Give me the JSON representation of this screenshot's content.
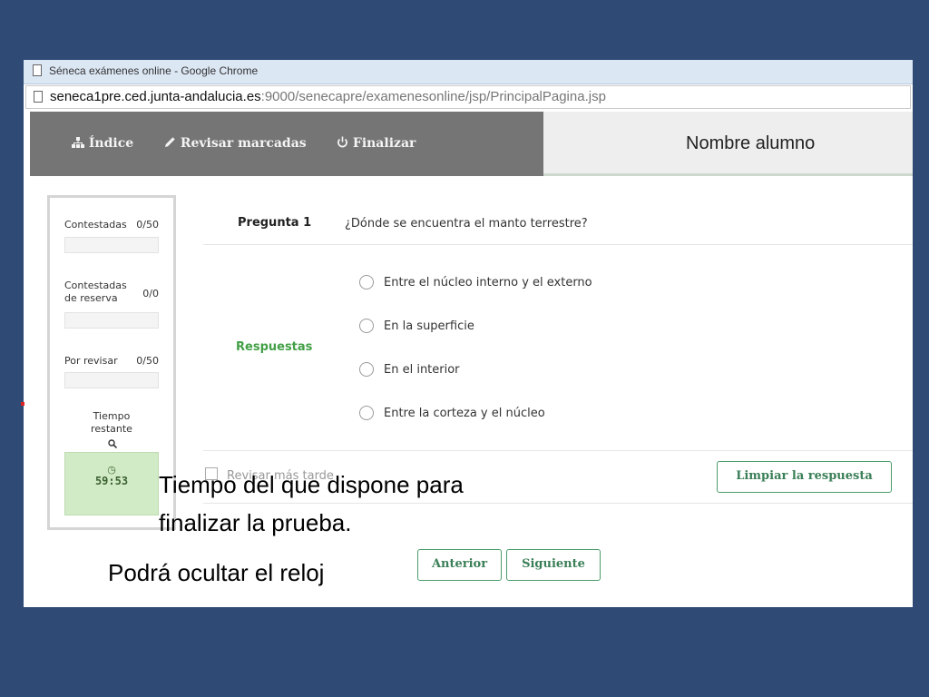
{
  "browser": {
    "window_title": "Séneca exámenes online - Google Chrome",
    "url_domain": "seneca1pre.ced.junta-andalucia.es",
    "url_path": ":9000/senecapre/examenesonline/jsp/PrincipalPagina.jsp"
  },
  "nav": {
    "index_label": "Índice",
    "review_marked_label": "Revisar marcadas",
    "finish_label": "Finalizar",
    "student_name": "Nombre alumno"
  },
  "sidebar": {
    "answered_label": "Contestadas",
    "answered_count": "0/50",
    "reserve_label_line1": "Contestadas",
    "reserve_label_line2": "de reserva",
    "reserve_count": "0/0",
    "to_review_label": "Por revisar",
    "to_review_count": "0/50",
    "time_label_line1": "Tiempo",
    "time_label_line2": "restante",
    "time_remaining": "59:53"
  },
  "question": {
    "number_label": "Pregunta 1",
    "text": "¿Dónde se encuentra el manto terrestre?",
    "answers_label": "Respuestas",
    "options": [
      "Entre el núcleo interno y el externo",
      "En la superficie",
      "En el interior",
      "Entre la corteza y el núcleo"
    ],
    "review_later_label": "Revisar más tarde",
    "clear_answer_label": "Limpiar la respuesta"
  },
  "pagination": {
    "previous_label": "Anterior",
    "next_label": "Siguiente"
  },
  "captions": {
    "time_line1": "Tiempo del que dispone para",
    "time_line2": "finalizar la prueba.",
    "hide_clock": "Podrá ocultar el reloj"
  }
}
